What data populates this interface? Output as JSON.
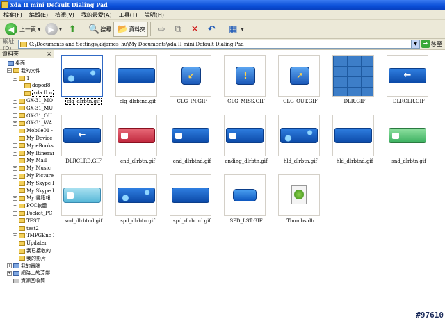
{
  "window": {
    "title": "xda II mini Default Dialing Pad"
  },
  "menu": [
    "檔案(F)",
    "編輯(E)",
    "檢視(V)",
    "我的最愛(A)",
    "工具(T)",
    "說明(H)"
  ],
  "toolbar": {
    "back_label": "上一頁",
    "search_label": "搜尋",
    "folders_label": "資料夾"
  },
  "address": {
    "label": "網址(D)",
    "value": "C:\\Documents and Settings\\kkjames_hu\\My Documents\\xda II mini Default Dialing Pad",
    "go_label": "移至"
  },
  "folder_pane": {
    "title": "資料夾",
    "close": "×",
    "items": [
      {
        "label": "桌面",
        "indent": 0,
        "expander": "",
        "icon": "desktop"
      },
      {
        "label": "我的文件",
        "indent": 1,
        "expander": "−",
        "icon": "docs"
      },
      {
        "label": "1",
        "indent": 2,
        "expander": "−",
        "icon": "folder"
      },
      {
        "label": "dopod8",
        "indent": 3,
        "expander": "",
        "icon": "folder"
      },
      {
        "label": "xda II n",
        "indent": 3,
        "expander": "",
        "icon": "folder",
        "selected": true
      },
      {
        "label": "GX-31_MO",
        "indent": 2,
        "expander": "+",
        "icon": "folder"
      },
      {
        "label": "GX-31_MU",
        "indent": 2,
        "expander": "+",
        "icon": "folder"
      },
      {
        "label": "GX-31_OU",
        "indent": 2,
        "expander": "+",
        "icon": "folder"
      },
      {
        "label": "GX-31_WA",
        "indent": 2,
        "expander": "+",
        "icon": "folder"
      },
      {
        "label": "Mobile01 -",
        "indent": 2,
        "expander": "",
        "icon": "folder"
      },
      {
        "label": "My Device",
        "indent": 2,
        "expander": "",
        "icon": "folder"
      },
      {
        "label": "My eBooks",
        "indent": 2,
        "expander": "+",
        "icon": "folder"
      },
      {
        "label": "My Itinerar",
        "indent": 2,
        "expander": "+",
        "icon": "folder"
      },
      {
        "label": "My Mail",
        "indent": 2,
        "expander": "",
        "icon": "folder"
      },
      {
        "label": "My Music",
        "indent": 2,
        "expander": "+",
        "icon": "folder"
      },
      {
        "label": "My Pictures",
        "indent": 2,
        "expander": "+",
        "icon": "folder"
      },
      {
        "label": "My Skype F",
        "indent": 2,
        "expander": "",
        "icon": "folder"
      },
      {
        "label": "My Skype F",
        "indent": 2,
        "expander": "",
        "icon": "folder"
      },
      {
        "label": "My 書籍報",
        "indent": 2,
        "expander": "+",
        "icon": "folder"
      },
      {
        "label": "PCC軟體",
        "indent": 2,
        "expander": "+",
        "icon": "folder"
      },
      {
        "label": "Pocket_PC",
        "indent": 2,
        "expander": "+",
        "icon": "folder"
      },
      {
        "label": "TEST",
        "indent": 2,
        "expander": "",
        "icon": "folder"
      },
      {
        "label": "test2",
        "indent": 2,
        "expander": "",
        "icon": "folder"
      },
      {
        "label": "TMPGEnc 3",
        "indent": 2,
        "expander": "+",
        "icon": "folder"
      },
      {
        "label": "Updater",
        "indent": 2,
        "expander": "",
        "icon": "folder"
      },
      {
        "label": "我已接收的",
        "indent": 2,
        "expander": "",
        "icon": "folder"
      },
      {
        "label": "我的影片",
        "indent": 2,
        "expander": "",
        "icon": "folder"
      },
      {
        "label": "我的電腦",
        "indent": 1,
        "expander": "+",
        "icon": "computer"
      },
      {
        "label": "網路上的芳鄰",
        "indent": 1,
        "expander": "+",
        "icon": "network"
      },
      {
        "label": "資源回收筒",
        "indent": 1,
        "expander": "",
        "icon": "recycle"
      }
    ]
  },
  "files": [
    {
      "name": "clg_dlrbtn.gif",
      "thumb": "btn-blue-spl",
      "selected": true
    },
    {
      "name": "clg_dlrbtnd.gif",
      "thumb": "btn-blue"
    },
    {
      "name": "CLG_IN.GIF",
      "thumb": "icon-in"
    },
    {
      "name": "CLG_MISS.GIF",
      "thumb": "icon-miss"
    },
    {
      "name": "CLG_OUT.GIF",
      "thumb": "icon-out"
    },
    {
      "name": "DLR.GIF",
      "thumb": "dlr-grid"
    },
    {
      "name": "DLRCLR.GIF",
      "thumb": "btn-arrow"
    },
    {
      "name": "DLRCLRD.GIF",
      "thumb": "btn-arrow"
    },
    {
      "name": "end_dlrbtn.gif",
      "thumb": "btn-red"
    },
    {
      "name": "end_dlrbtnd.gif",
      "thumb": "btn-blue-phone"
    },
    {
      "name": "ending_dlrbtn.gif",
      "thumb": "btn-blue-phone"
    },
    {
      "name": "hld_dlrbtn.gif",
      "thumb": "btn-blue-spl"
    },
    {
      "name": "hld_dlrbtnd.gif",
      "thumb": "btn-blue"
    },
    {
      "name": "snd_dlrbtn.gif",
      "thumb": "btn-green"
    },
    {
      "name": "snd_dlrbtnd.gif",
      "thumb": "btn-lightblue"
    },
    {
      "name": "spd_dlrbtn.gif",
      "thumb": "btn-blue-spl"
    },
    {
      "name": "spd_dlrbtnd.gif",
      "thumb": "btn-blue"
    },
    {
      "name": "SPD_LST.GIF",
      "thumb": "lst"
    },
    {
      "name": "Thumbs.db",
      "thumb": "thumbsdb"
    }
  ],
  "watermark": "#97610"
}
